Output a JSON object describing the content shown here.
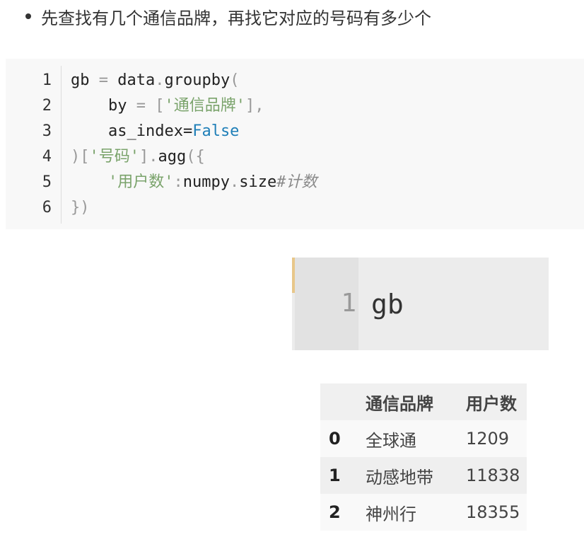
{
  "bullet": {
    "text": "先查找有几个通信品牌，再找它对应的号码有多少个"
  },
  "code": {
    "line_numbers": [
      "1",
      "2",
      "3",
      "4",
      "5",
      "6"
    ],
    "lines": [
      [
        {
          "t": "gb ",
          "c": ""
        },
        {
          "t": "=",
          "c": "op"
        },
        {
          "t": " data",
          "c": ""
        },
        {
          "t": ".",
          "c": "op"
        },
        {
          "t": "groupby",
          "c": ""
        },
        {
          "t": "(",
          "c": "op"
        }
      ],
      [
        {
          "t": "    by ",
          "c": ""
        },
        {
          "t": "=",
          "c": "op"
        },
        {
          "t": " [",
          "c": "op"
        },
        {
          "t": "'通信品牌'",
          "c": "str"
        },
        {
          "t": "],",
          "c": "op"
        }
      ],
      [
        {
          "t": "    as_index",
          "c": ""
        },
        {
          "t": "=",
          "c": ""
        },
        {
          "t": "False",
          "c": "kw"
        }
      ],
      [
        {
          "t": ")[",
          "c": "op"
        },
        {
          "t": "'号码'",
          "c": "str"
        },
        {
          "t": "]",
          "c": "op"
        },
        {
          "t": ".",
          "c": "op"
        },
        {
          "t": "agg",
          "c": ""
        },
        {
          "t": "({",
          "c": "op"
        }
      ],
      [
        {
          "t": "    ",
          "c": ""
        },
        {
          "t": "'用户数'",
          "c": "str"
        },
        {
          "t": ":",
          "c": "op"
        },
        {
          "t": "numpy",
          "c": ""
        },
        {
          "t": ".",
          "c": "op"
        },
        {
          "t": "size",
          "c": ""
        },
        {
          "t": "#计数",
          "c": "cm"
        }
      ],
      [
        {
          "t": "})",
          "c": "op"
        }
      ]
    ]
  },
  "cell": {
    "line_number": "1",
    "code": "gb"
  },
  "dataframe": {
    "columns": [
      "",
      "通信品牌",
      "用户数"
    ],
    "rows": [
      {
        "index": "0",
        "brand": "全球通",
        "count": "1209"
      },
      {
        "index": "1",
        "brand": "动感地带",
        "count": "11838"
      },
      {
        "index": "2",
        "brand": "神州行",
        "count": "18355"
      }
    ]
  },
  "colors": {
    "string": "#7aa36b",
    "keyword": "#1f7fb8",
    "operator": "#999999",
    "cell_accent": "#e8c78a"
  }
}
